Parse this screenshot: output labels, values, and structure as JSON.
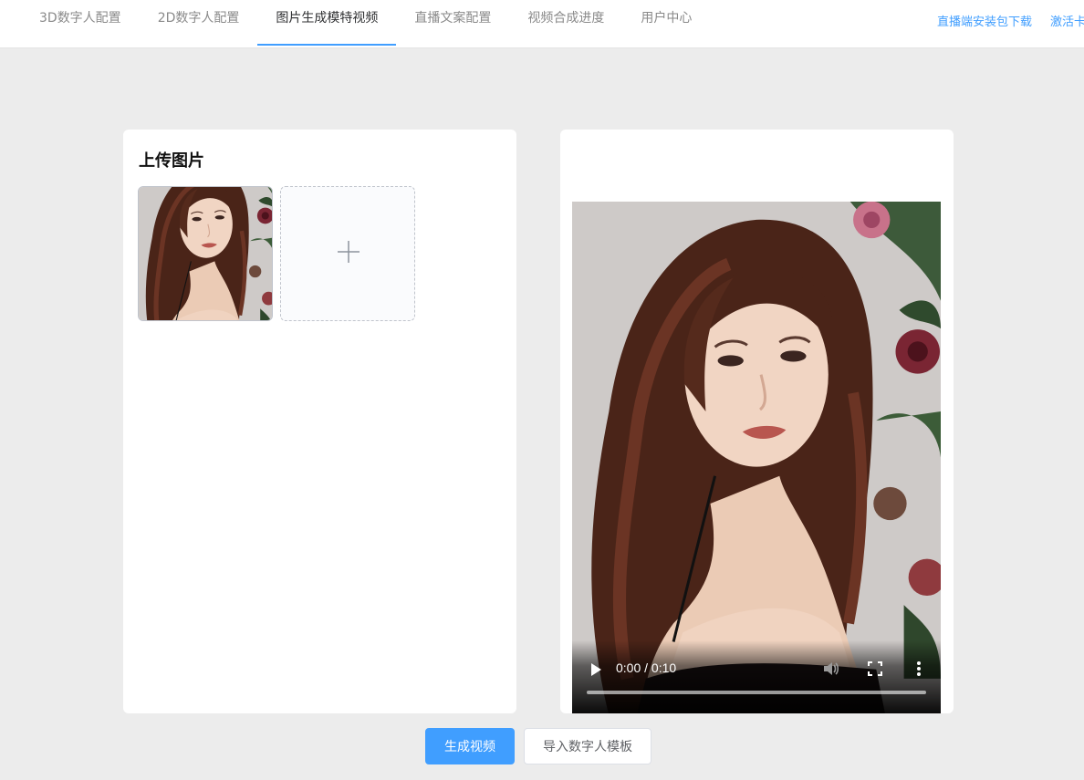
{
  "nav": {
    "tabs": [
      {
        "label": "3D数字人配置"
      },
      {
        "label": "2D数字人配置"
      },
      {
        "label": "图片生成模特视频",
        "active": true
      },
      {
        "label": "直播文案配置"
      },
      {
        "label": "视频合成进度"
      },
      {
        "label": "用户中心"
      }
    ],
    "links": [
      {
        "label": "直播端安装包下载"
      },
      {
        "label": "激活卡"
      }
    ]
  },
  "upload": {
    "title": "上传图片",
    "plus_icon": "plus-icon"
  },
  "video": {
    "time": "0:00 / 0:10",
    "progress": 0
  },
  "actions": {
    "generate_label": "生成视频",
    "import_label": "导入数字人模板"
  },
  "colors": {
    "accent": "#409eff",
    "background": "#ececec"
  }
}
